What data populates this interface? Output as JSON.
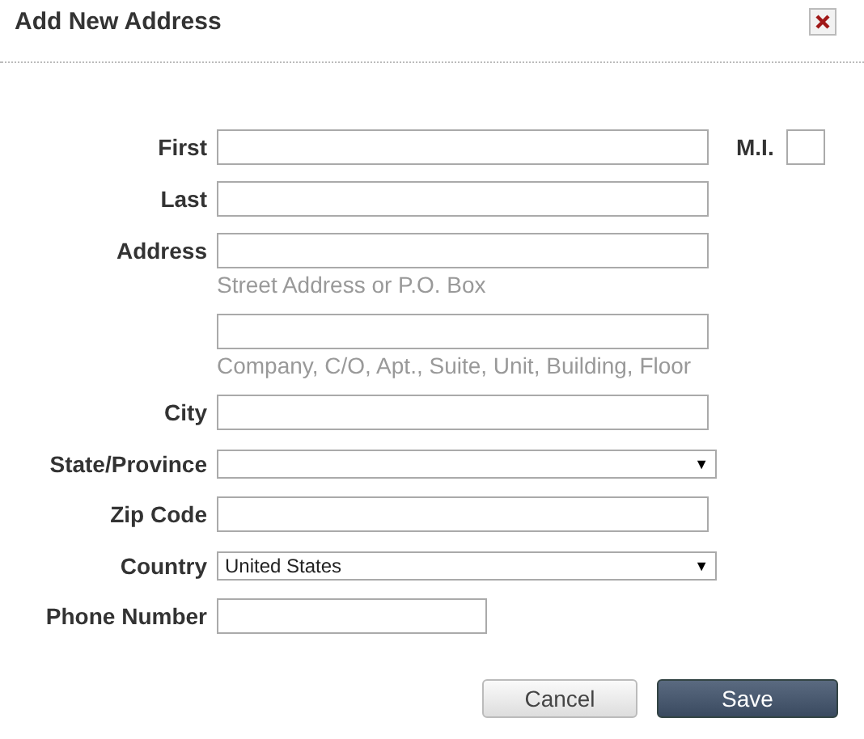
{
  "dialog": {
    "title": "Add New Address"
  },
  "fields": [
    {
      "kind": "text",
      "label": "First",
      "extra": {
        "label": "M.I."
      }
    },
    {
      "kind": "text",
      "label": "Last"
    },
    {
      "kind": "text",
      "label": "Address",
      "hint": "Street Address or P.O. Box"
    },
    {
      "kind": "text",
      "hint": "Company, C/O, Apt., Suite, Unit, Building, Floor"
    },
    {
      "kind": "text",
      "label": "City"
    },
    {
      "kind": "select",
      "label": "State/Province",
      "arrow": "▼"
    },
    {
      "kind": "text",
      "label": "Zip Code"
    },
    {
      "kind": "select",
      "label": "Country",
      "value": "United States",
      "arrow": "▼"
    },
    {
      "kind": "short-text",
      "label": "Phone Number"
    }
  ],
  "buttons": [
    {
      "label": "Cancel",
      "kind": "secondary"
    },
    {
      "label": "Save",
      "kind": "primary"
    }
  ]
}
